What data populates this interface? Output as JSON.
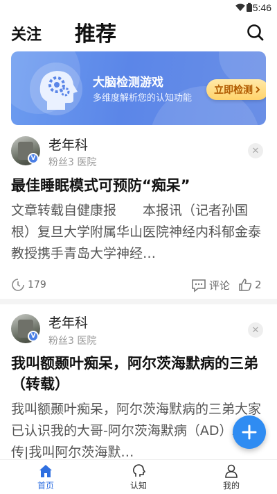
{
  "status_bar": {
    "time": "5:46"
  },
  "top_nav": {
    "follow_tab": "关注",
    "recommend_tab": "推荐"
  },
  "banner": {
    "title": "大脑检测游戏",
    "subtitle": "多维度解析您的认知功能",
    "button": "立即检测"
  },
  "posts": [
    {
      "author": "老年科",
      "meta": "粉丝3  医院",
      "title": "最佳睡眠模式可预防“痴呆”",
      "excerpt": "文章转载自健康报　　本报讯（记者孙国根）复旦大学附属华山医院神经内科郁金泰教授携手青岛大学神经…",
      "views": "179",
      "comment_label": "评论",
      "likes": "2"
    },
    {
      "author": "老年科",
      "meta": "粉丝3  医院",
      "title": "我叫额颞叶痴呆，阿尔茨海默病的三弟（转载）",
      "excerpt": "我叫额颞叶痴呆，阿尔茨海默病的三弟大家已认识我的大哥-阿尔茨海默病（AD）AD小传|我叫阿尔茨海默…"
    }
  ],
  "bottom_nav": [
    {
      "label": "首页",
      "icon": "home-icon",
      "active": true
    },
    {
      "label": "认知",
      "icon": "brain-icon",
      "active": false
    },
    {
      "label": "我的",
      "icon": "person-icon",
      "active": false
    }
  ],
  "colors": {
    "accent": "#2f6fe0",
    "fab": "#2f8cf2",
    "banner": "#5b86e8",
    "banner_button": "#ffd36b"
  }
}
